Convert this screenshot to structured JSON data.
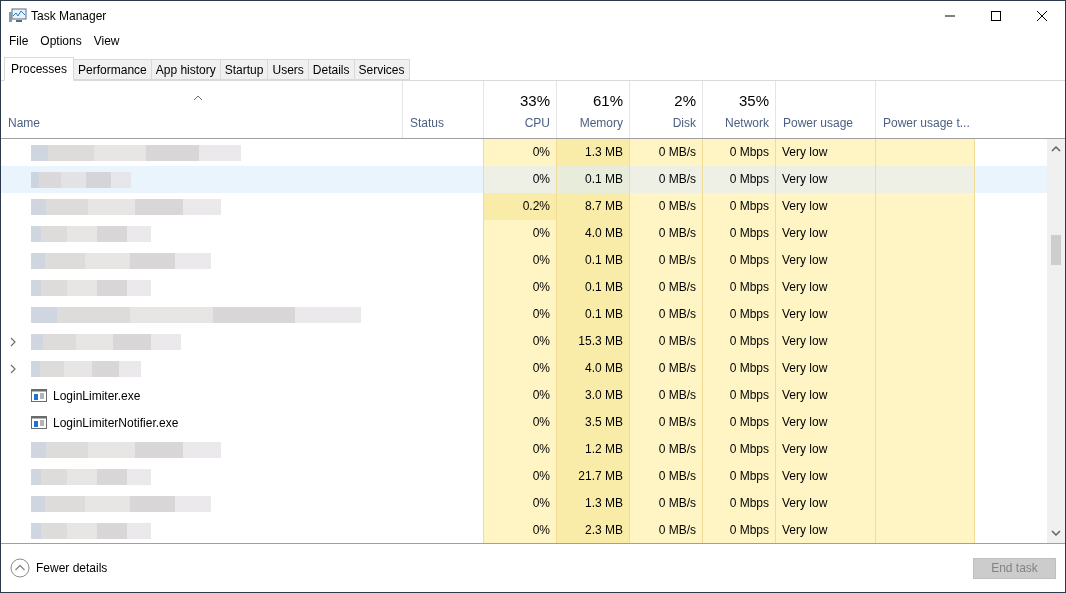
{
  "window": {
    "title": "Task Manager"
  },
  "menu": [
    "File",
    "Options",
    "View"
  ],
  "tabs": [
    {
      "label": "Processes",
      "selected": true
    },
    {
      "label": "Performance",
      "selected": false
    },
    {
      "label": "App history",
      "selected": false
    },
    {
      "label": "Startup",
      "selected": false
    },
    {
      "label": "Users",
      "selected": false
    },
    {
      "label": "Details",
      "selected": false
    },
    {
      "label": "Services",
      "selected": false
    }
  ],
  "table": {
    "columns": [
      {
        "label": "Name"
      },
      {
        "label": "Status"
      },
      {
        "label": "CPU",
        "total": "33%"
      },
      {
        "label": "Memory",
        "total": "61%"
      },
      {
        "label": "Disk",
        "total": "2%"
      },
      {
        "label": "Network",
        "total": "35%"
      },
      {
        "label": "Power usage"
      },
      {
        "label": "Power usage t..."
      }
    ],
    "rows": [
      {
        "kind": "redacted",
        "selected": false,
        "expandable": false,
        "cpu": "0%",
        "cpu_active": false,
        "memory": "1.3 MB",
        "disk": "0 MB/s",
        "network": "0 Mbps",
        "power": "Very low"
      },
      {
        "kind": "redacted",
        "selected": true,
        "expandable": false,
        "cpu": "0%",
        "cpu_active": false,
        "memory": "0.1 MB",
        "disk": "0 MB/s",
        "network": "0 Mbps",
        "power": "Very low"
      },
      {
        "kind": "redacted",
        "selected": false,
        "expandable": false,
        "cpu": "0.2%",
        "cpu_active": true,
        "memory": "8.7 MB",
        "disk": "0 MB/s",
        "network": "0 Mbps",
        "power": "Very low"
      },
      {
        "kind": "redacted",
        "selected": false,
        "expandable": false,
        "cpu": "0%",
        "cpu_active": false,
        "memory": "4.0 MB",
        "disk": "0 MB/s",
        "network": "0 Mbps",
        "power": "Very low"
      },
      {
        "kind": "redacted",
        "selected": false,
        "expandable": false,
        "cpu": "0%",
        "cpu_active": false,
        "memory": "0.1 MB",
        "disk": "0 MB/s",
        "network": "0 Mbps",
        "power": "Very low"
      },
      {
        "kind": "redacted",
        "selected": false,
        "expandable": false,
        "cpu": "0%",
        "cpu_active": false,
        "memory": "0.1 MB",
        "disk": "0 MB/s",
        "network": "0 Mbps",
        "power": "Very low"
      },
      {
        "kind": "redacted",
        "selected": false,
        "expandable": false,
        "cpu": "0%",
        "cpu_active": false,
        "memory": "0.1 MB",
        "disk": "0 MB/s",
        "network": "0 Mbps",
        "power": "Very low"
      },
      {
        "kind": "redacted",
        "selected": false,
        "expandable": true,
        "cpu": "0%",
        "cpu_active": false,
        "memory": "15.3 MB",
        "disk": "0 MB/s",
        "network": "0 Mbps",
        "power": "Very low"
      },
      {
        "kind": "redacted",
        "selected": false,
        "expandable": true,
        "cpu": "0%",
        "cpu_active": false,
        "memory": "4.0 MB",
        "disk": "0 MB/s",
        "network": "0 Mbps",
        "power": "Very low"
      },
      {
        "kind": "named",
        "name": "LoginLimiter.exe",
        "selected": false,
        "expandable": false,
        "cpu": "0%",
        "cpu_active": false,
        "memory": "3.0 MB",
        "disk": "0 MB/s",
        "network": "0 Mbps",
        "power": "Very low"
      },
      {
        "kind": "named",
        "name": "LoginLimiterNotifier.exe",
        "selected": false,
        "expandable": false,
        "cpu": "0%",
        "cpu_active": false,
        "memory": "3.5 MB",
        "disk": "0 MB/s",
        "network": "0 Mbps",
        "power": "Very low"
      },
      {
        "kind": "redacted",
        "selected": false,
        "expandable": false,
        "cpu": "0%",
        "cpu_active": false,
        "memory": "1.2 MB",
        "disk": "0 MB/s",
        "network": "0 Mbps",
        "power": "Very low"
      },
      {
        "kind": "redacted",
        "selected": false,
        "expandable": false,
        "cpu": "0%",
        "cpu_active": false,
        "memory": "21.7 MB",
        "disk": "0 MB/s",
        "network": "0 Mbps",
        "power": "Very low"
      },
      {
        "kind": "redacted",
        "selected": false,
        "expandable": false,
        "cpu": "0%",
        "cpu_active": false,
        "memory": "1.3 MB",
        "disk": "0 MB/s",
        "network": "0 Mbps",
        "power": "Very low"
      },
      {
        "kind": "redacted",
        "selected": false,
        "expandable": false,
        "cpu": "0%",
        "cpu_active": false,
        "memory": "2.3 MB",
        "disk": "0 MB/s",
        "network": "0 Mbps",
        "power": "Very low"
      }
    ]
  },
  "footer": {
    "details_toggle": "Fewer details",
    "end_task": {
      "label": "End task",
      "disabled": true
    }
  }
}
